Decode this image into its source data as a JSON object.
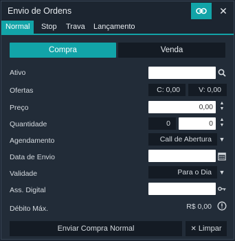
{
  "window": {
    "title": "Envio de Ordens"
  },
  "tabs": [
    {
      "label": "Normal"
    },
    {
      "label": "Stop"
    },
    {
      "label": "Trava"
    },
    {
      "label": "Lançamento"
    }
  ],
  "side": {
    "buy_label": "Compra",
    "sell_label": "Venda"
  },
  "form": {
    "ativo_label": "Ativo",
    "ativo_value": "",
    "ofertas_label": "Ofertas",
    "ofertas_compra": "C: 0,00",
    "ofertas_venda": "V: 0,00",
    "preco_label": "Preço",
    "preco_value": "0,00",
    "quantidade_label": "Quantidade",
    "quantidade_lot": "0",
    "quantidade_value": "0",
    "agendamento_label": "Agendamento",
    "agendamento_value": "Call de Abertura",
    "data_envio_label": "Data de Envio",
    "data_envio_value": "",
    "validade_label": "Validade",
    "validade_value": "Para o Dia",
    "ass_digital_label": "Ass. Digital",
    "ass_digital_value": "",
    "debito_label": "Débito Máx.",
    "debito_value": "R$ 0,00"
  },
  "footer": {
    "submit_label": "Enviar Compra Normal",
    "clear_label": "Limpar"
  },
  "icons": {
    "link": "link-icon",
    "close": "close-icon",
    "search": "search-icon",
    "calendar": "calendar-icon",
    "key": "key-icon",
    "info": "info-icon",
    "dropdown": "caret-down-icon",
    "spinner": "spinner-arrows-icon",
    "clear": "x-icon"
  },
  "colors": {
    "accent": "#12a4a8",
    "panel": "#222c38",
    "dark": "#141b24"
  }
}
